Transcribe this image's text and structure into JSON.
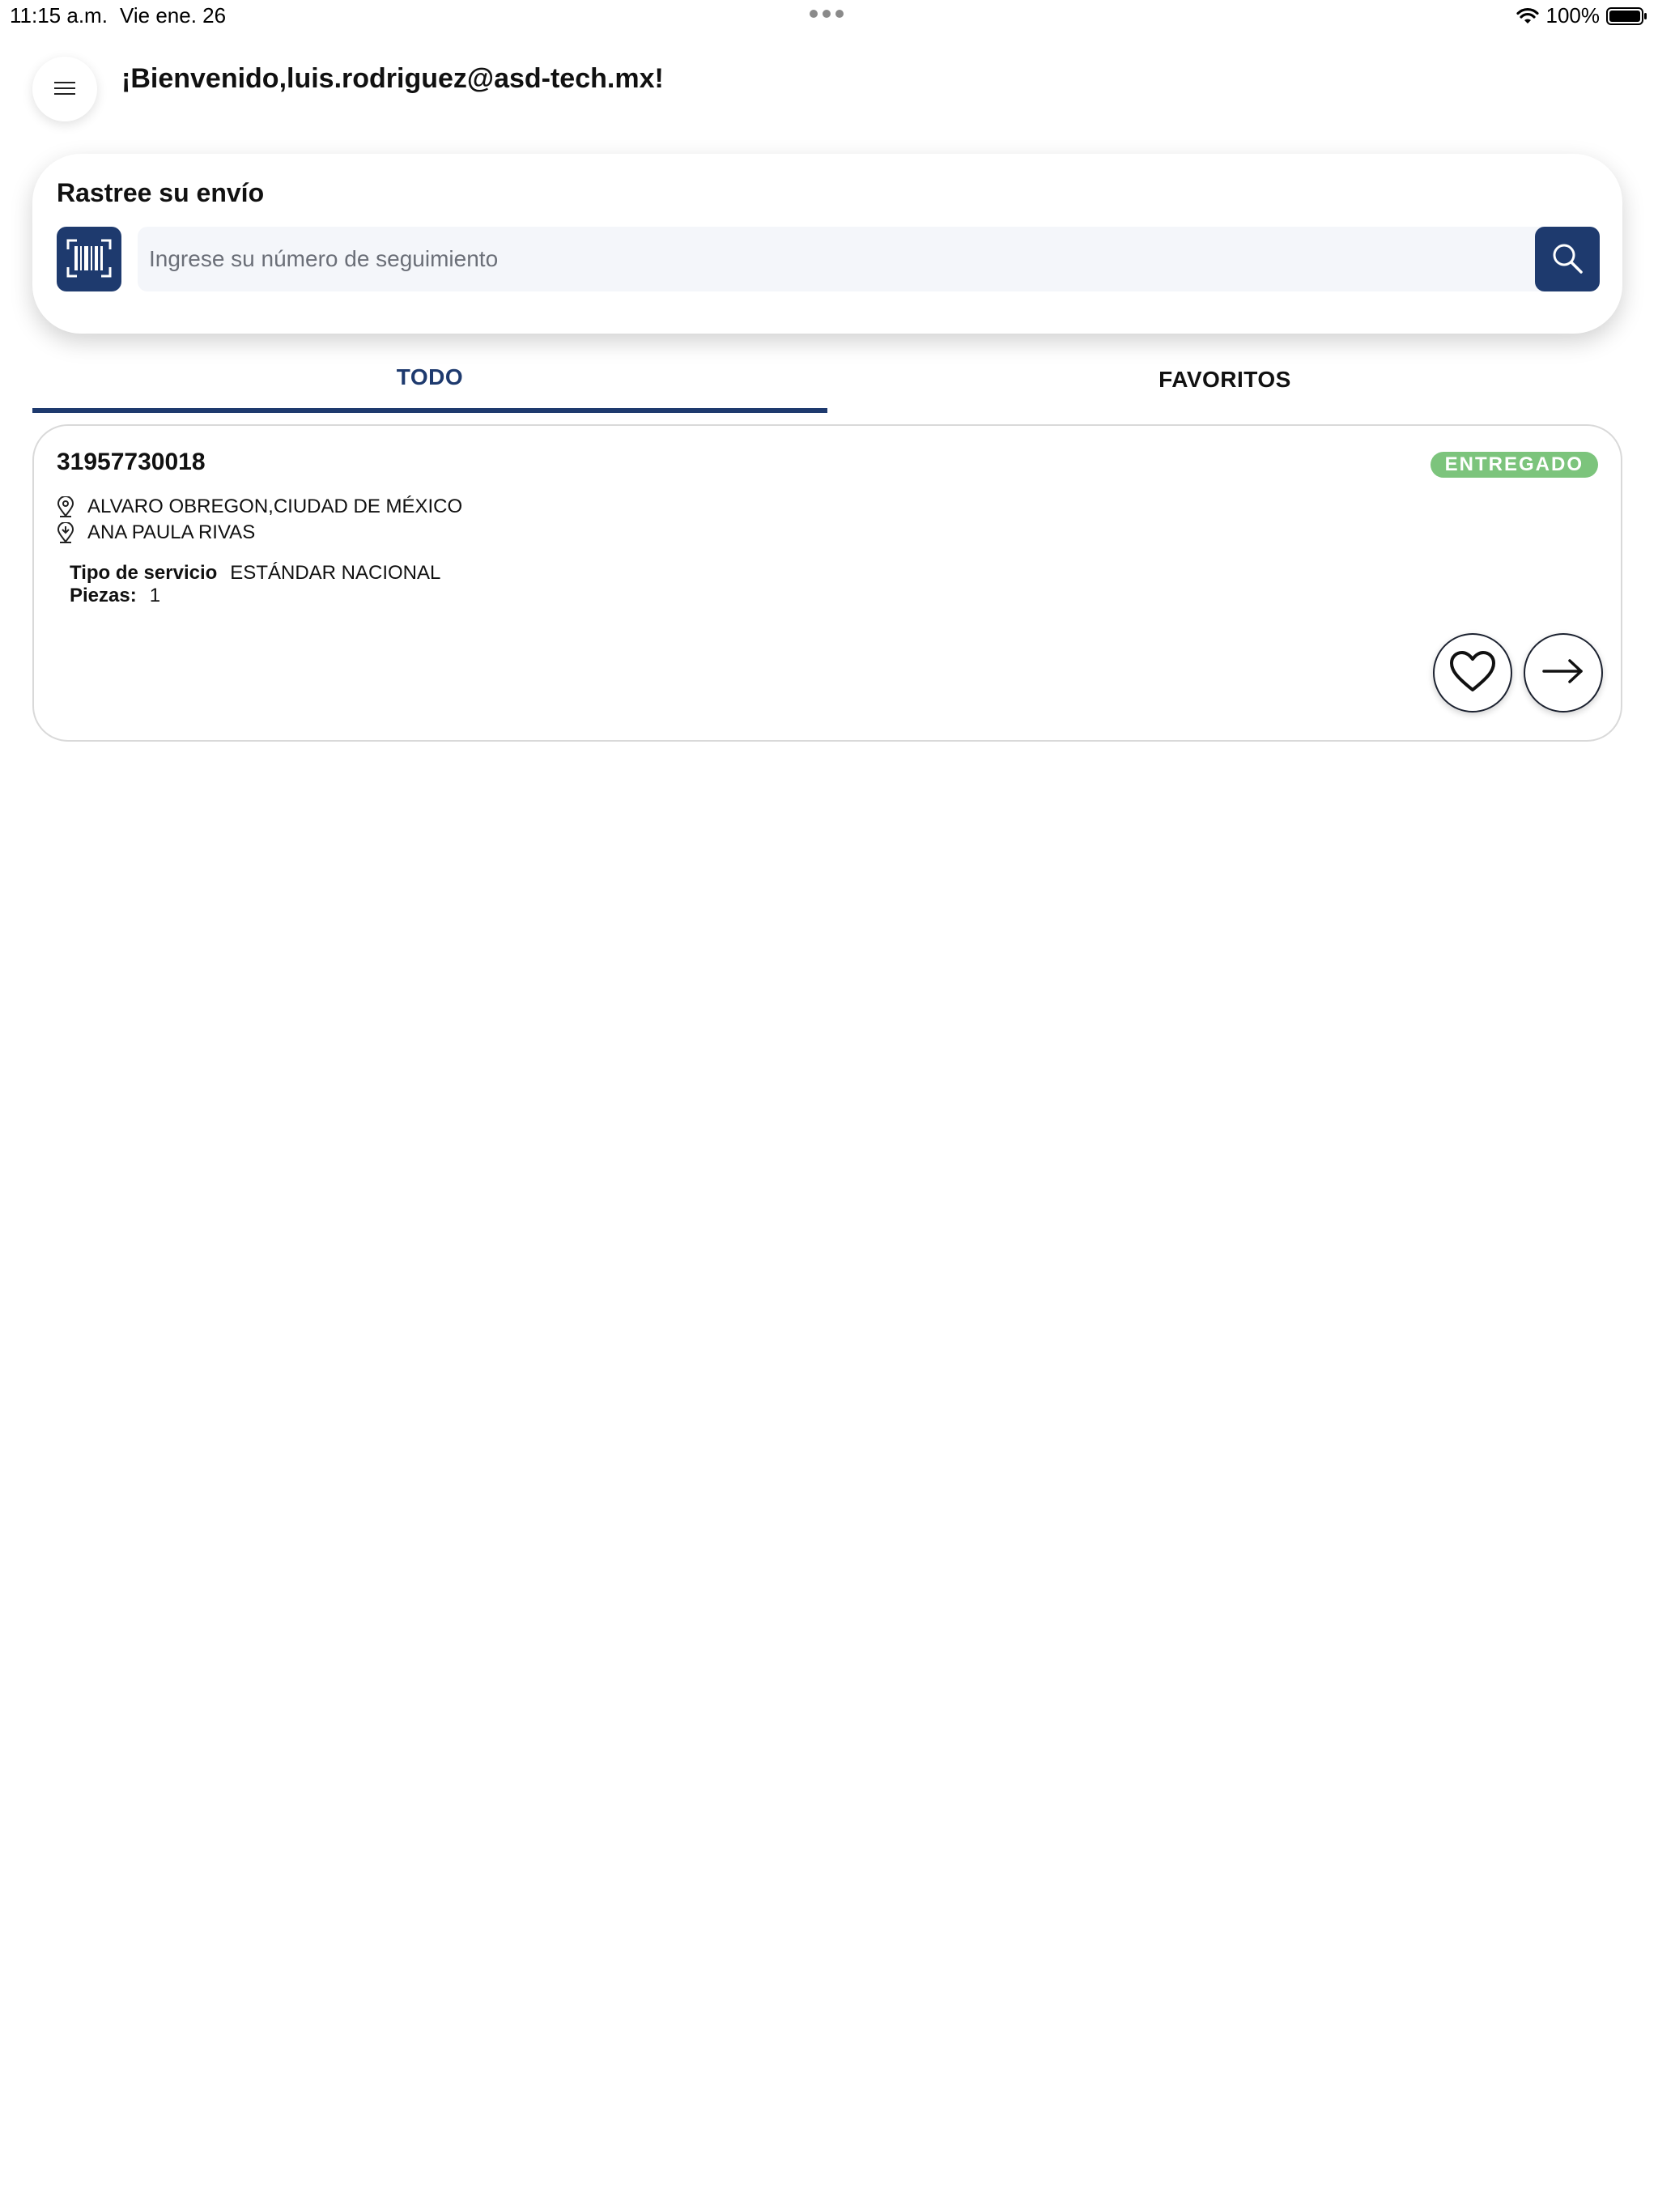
{
  "status_bar": {
    "time": "11:15 a.m.",
    "date": "Vie ene. 26",
    "battery": "100%"
  },
  "header": {
    "welcome": "¡Bienvenido,luis.rodriguez@asd-tech.mx!"
  },
  "tracking": {
    "title": "Rastree su envío",
    "placeholder": "Ingrese su número de seguimiento",
    "value": ""
  },
  "tabs": [
    {
      "label": "TODO",
      "active": true
    },
    {
      "label": "FAVORITOS",
      "active": false
    }
  ],
  "shipments": [
    {
      "number": "31957730018",
      "status": "ENTREGADO",
      "origin": "ALVARO OBREGON,CIUDAD DE MÉXICO",
      "destination": "ANA PAULA RIVAS",
      "service_label": "Tipo de servicio",
      "service_value": "ESTÁNDAR NACIONAL",
      "pieces_label": "Piezas:",
      "pieces_value": "1"
    }
  ],
  "colors": {
    "primary": "#1e3a6e",
    "delivered_badge": "#7cc47c",
    "input_bg": "#f4f6fa"
  },
  "icons": {
    "menu": "hamburger-menu-icon",
    "scan": "barcode-scan-icon",
    "search": "search-icon",
    "origin": "location-pin-icon",
    "destination": "destination-pin-icon",
    "favorite": "heart-icon",
    "detail": "arrow-right-icon"
  }
}
